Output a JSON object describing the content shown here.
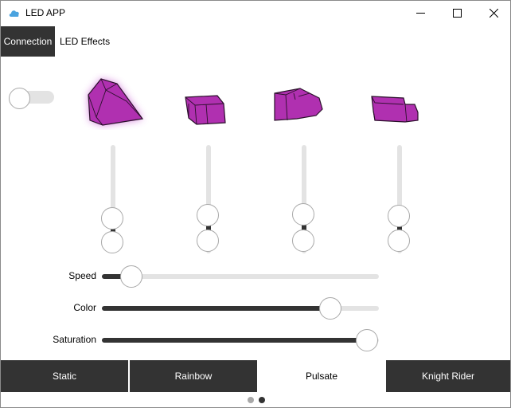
{
  "window": {
    "title": "LED APP",
    "accent_icon_color": "#4aa3df"
  },
  "topnav": {
    "tabs": [
      {
        "label": "Connection",
        "active": true
      },
      {
        "label": "LED Effects",
        "active": false
      }
    ]
  },
  "power_toggle": {
    "on": false
  },
  "leds": [
    {
      "name": "led-1",
      "color": "#b030b0",
      "glowing": true
    },
    {
      "name": "led-2",
      "color": "#b030b0",
      "glowing": false
    },
    {
      "name": "led-3",
      "color": "#b030b0",
      "glowing": false
    },
    {
      "name": "led-4",
      "color": "#b030b0",
      "glowing": false
    }
  ],
  "range_sliders": [
    {
      "low": 0.18,
      "high": 0.35
    },
    {
      "low": 0.2,
      "high": 0.4
    },
    {
      "low": 0.2,
      "high": 0.4
    },
    {
      "low": 0.2,
      "high": 0.38
    }
  ],
  "controls": {
    "speed": {
      "label": "Speed",
      "value": 0.1
    },
    "color": {
      "label": "Color",
      "value": 0.83
    },
    "saturation": {
      "label": "Saturation",
      "value": 0.96
    }
  },
  "effects": {
    "tabs": [
      {
        "label": "Static",
        "selected": false
      },
      {
        "label": "Rainbow",
        "selected": false
      },
      {
        "label": "Pulsate",
        "selected": true
      },
      {
        "label": "Knight Rider",
        "selected": false
      }
    ]
  },
  "pager": {
    "page": 2,
    "pages": 2
  }
}
